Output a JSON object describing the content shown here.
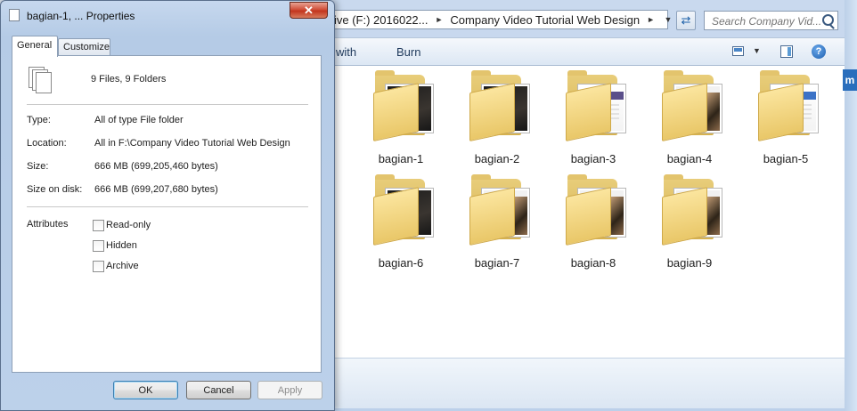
{
  "explorer": {
    "breadcrumb": {
      "drive_fragment": "ive (F:) 2016022...",
      "folder": "Company Video Tutorial Web Design"
    },
    "search": {
      "placeholder": "Search Company Vid..."
    },
    "toolbar": {
      "share_with_fragment": "with",
      "burn_label": "Burn"
    },
    "right_tab_label": "m",
    "folders": [
      {
        "name": "bagian-1",
        "thumb": "dark"
      },
      {
        "name": "bagian-2",
        "thumb": "dark"
      },
      {
        "name": "bagian-3",
        "thumb": "light"
      },
      {
        "name": "bagian-4",
        "thumb": "photo"
      },
      {
        "name": "bagian-5",
        "thumb": "light-blue"
      },
      {
        "name": "bagian-6",
        "thumb": "dark"
      },
      {
        "name": "bagian-7",
        "thumb": "photo"
      },
      {
        "name": "bagian-8",
        "thumb": "photo"
      },
      {
        "name": "bagian-9",
        "thumb": "photo"
      }
    ],
    "icons": [
      "chevron-right-icon",
      "chevron-down-icon",
      "refresh-icon",
      "search-icon",
      "views-icon",
      "preview-pane-icon",
      "help-icon",
      "folder-icon"
    ]
  },
  "dialog": {
    "title": "bagian-1, ... Properties",
    "close_glyph": "✕",
    "tabs": [
      "General",
      "Customize"
    ],
    "summary": "9 Files, 9 Folders",
    "fields": {
      "type_label": "Type:",
      "type_value": "All of type File folder",
      "location_label": "Location:",
      "location_value": "All in F:\\Company Video Tutorial Web Design",
      "size_label": "Size:",
      "size_value": "666 MB (699,205,460 bytes)",
      "size_on_disk_label": "Size on disk:",
      "size_on_disk_value": "666 MB (699,207,680 bytes)"
    },
    "attributes": {
      "label": "Attributes",
      "read_only": "Read-only",
      "hidden": "Hidden",
      "archive": "Archive"
    },
    "buttons": {
      "ok": "OK",
      "cancel": "Cancel",
      "apply": "Apply"
    }
  },
  "colors": {
    "accent": "#3c7fb1",
    "close_red": "#c2351e",
    "folder_yellow": "#e9c768",
    "chrome_blue": "#bcd1ea"
  }
}
